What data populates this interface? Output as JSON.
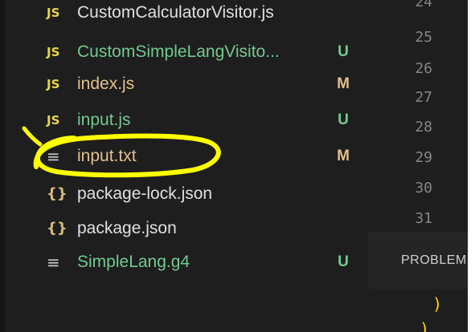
{
  "explorer": {
    "files": [
      {
        "icon": "JS",
        "icon_name": "js-file-icon",
        "name": "CustomCalculatorVisitor.js",
        "status": "",
        "state": "plain"
      },
      {
        "icon": "JS",
        "icon_name": "js-file-icon",
        "name": "CustomSimpleLangVisito...",
        "status": "U",
        "state": "untracked"
      },
      {
        "icon": "JS",
        "icon_name": "js-file-icon",
        "name": "index.js",
        "status": "M",
        "state": "modified"
      },
      {
        "icon": "JS",
        "icon_name": "js-file-icon",
        "name": "input.js",
        "status": "U",
        "state": "untracked"
      },
      {
        "icon": "≡",
        "icon_name": "text-file-icon",
        "name": "input.txt",
        "status": "M",
        "state": "modified"
      },
      {
        "icon": "{}",
        "icon_name": "json-file-icon",
        "name": "package-lock.json",
        "status": "",
        "state": "plain"
      },
      {
        "icon": "{}",
        "icon_name": "json-file-icon",
        "name": "package.json",
        "status": "",
        "state": "plain"
      },
      {
        "icon": "≡",
        "icon_name": "text-file-icon",
        "name": "SimpleLang.g4",
        "status": "U",
        "state": "untracked"
      }
    ]
  },
  "editor": {
    "line_numbers": [
      "24",
      "25",
      "26",
      "27",
      "28",
      "29",
      "30",
      "31"
    ]
  },
  "panel": {
    "tab_label": "PROBLEM",
    "code_line": ")",
    "code_line_2": ")"
  },
  "colors": {
    "untracked": "#73c991",
    "modified": "#e2c08d",
    "js_icon": "#e8d44d",
    "annotation": "#ffff00"
  }
}
